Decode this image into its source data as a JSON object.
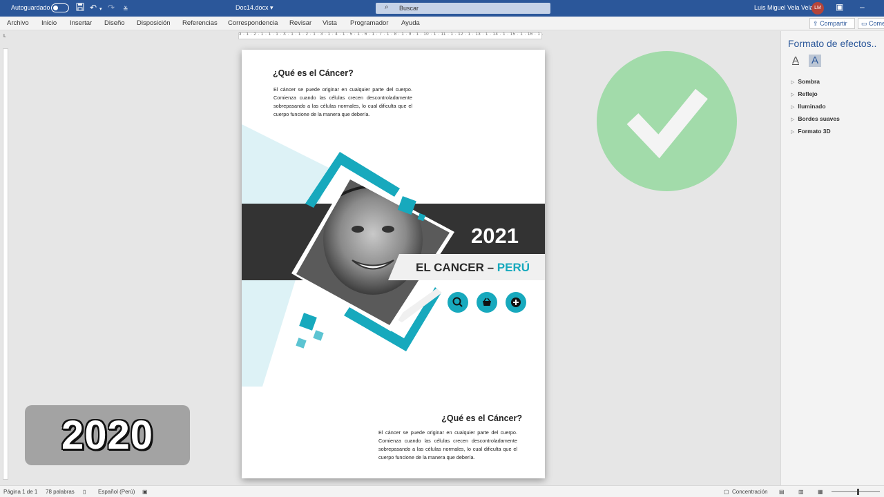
{
  "titlebar": {
    "autosave_label": "Autoguardado",
    "doc_name": "Doc14.docx",
    "doc_caret": "▾",
    "search_placeholder": "Buscar",
    "user_name": "Luis Miguel Vela Vela",
    "user_initials": "LM"
  },
  "tabs": [
    "Archivo",
    "Inicio",
    "Insertar",
    "Diseño",
    "Disposición",
    "Referencias",
    "Correspondencia",
    "Revisar",
    "Vista",
    "Programador",
    "Ayuda"
  ],
  "share_label": "Compartir",
  "comments_label": "Comentarios",
  "ruler_numbers": "3 · 1 · 2 · 1 · 1 · 1 · X · 1 · 1 · 2 · 1 · 3 · 1 · 4 · 1 · 5 · 1 · 6 · 1 · 7 · 1 · 8 · 1 · 9 · 1 · 10 · 1 · 11 · 1 · 12 · 1 · 13 · 1 · 14 · 1 · 15 · 1 · 16 · 1 · 17",
  "document": {
    "heading_top": "¿Qué es el Cáncer?",
    "paragraph_top": "El cáncer se puede originar en cualquier parte del cuerpo. Comienza cuando las células crecen descontroladamente sobrepasando a las células normales, lo cual dificulta que el cuerpo funcione de la manera que debería.",
    "year": "2021",
    "cover_title": "EL CANCER – ",
    "cover_title_accent": "PERÚ",
    "heading_bottom": "¿Qué es el Cáncer?",
    "paragraph_bottom": "El cáncer se puede originar en cualquier parte del cuerpo. Comienza cuando las células crecen descontroladamente sobrepasando a las células normales, lo cual dificulta que el cuerpo funcione de la manera que debería."
  },
  "side_pane": {
    "title": "Formato de efectos..",
    "items": [
      "Sombra",
      "Reflejo",
      "Iluminado",
      "Bordes suaves",
      "Formato 3D"
    ]
  },
  "overlay_year": "2020",
  "statusbar": {
    "page": "Página 1 de 1",
    "words": "78 palabras",
    "language": "Español (Perú)",
    "focus": "Concentración"
  },
  "colors": {
    "word_blue": "#2b579a",
    "accent_teal": "#17a9bd",
    "check_green": "#a2dbaa",
    "dark_band": "#333333"
  },
  "icons": [
    "save-icon",
    "undo-icon",
    "redo-icon",
    "search-icon",
    "basket-icon",
    "plus-icon",
    "check-icon"
  ]
}
